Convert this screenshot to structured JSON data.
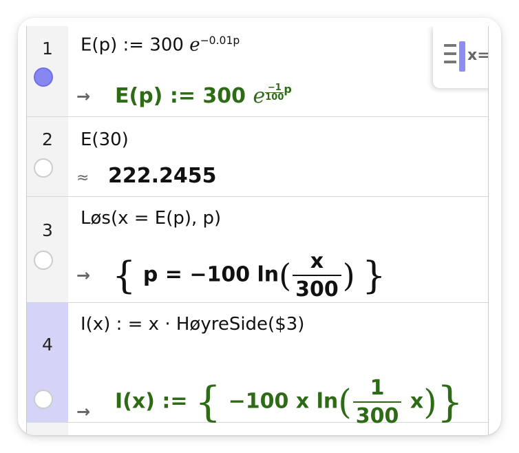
{
  "toolbar": {
    "algebra_button_label": "x="
  },
  "colors": {
    "accent": "#8787f2",
    "selected_row": "#d4d4f8",
    "output_green": "#2e6b17"
  },
  "rows": [
    {
      "number": "1",
      "input": {
        "prefix": "E(p) := 300 ",
        "base": "e",
        "exponent": "−0.01p"
      },
      "output": {
        "marker": "→",
        "prefix": "E(p)  :=  300 ",
        "base": "e",
        "frac_num": "−1",
        "frac_den": "100",
        "var": "p"
      }
    },
    {
      "number": "2",
      "input": {
        "text": "E(30)"
      },
      "output": {
        "marker": "≈",
        "value": "222.2455"
      }
    },
    {
      "number": "3",
      "input": {
        "text": "Løs(x  =  E(p),  p)"
      },
      "output": {
        "marker": "→",
        "open_brace": "{",
        "prefix": "p = −100  ln",
        "frac_num": "x",
        "frac_den": "300",
        "close_brace": "}"
      }
    },
    {
      "number": "4",
      "input": {
        "text": "I(x) : =  x · HøyreSide($3)"
      },
      "output": {
        "marker": "→",
        "lhs": "I(x)  :=  ",
        "open_brace": "{",
        "prefix": "−100 x  ln",
        "frac_num": "1",
        "frac_den": "300",
        "suffix": "x",
        "close_brace": "}"
      }
    }
  ]
}
